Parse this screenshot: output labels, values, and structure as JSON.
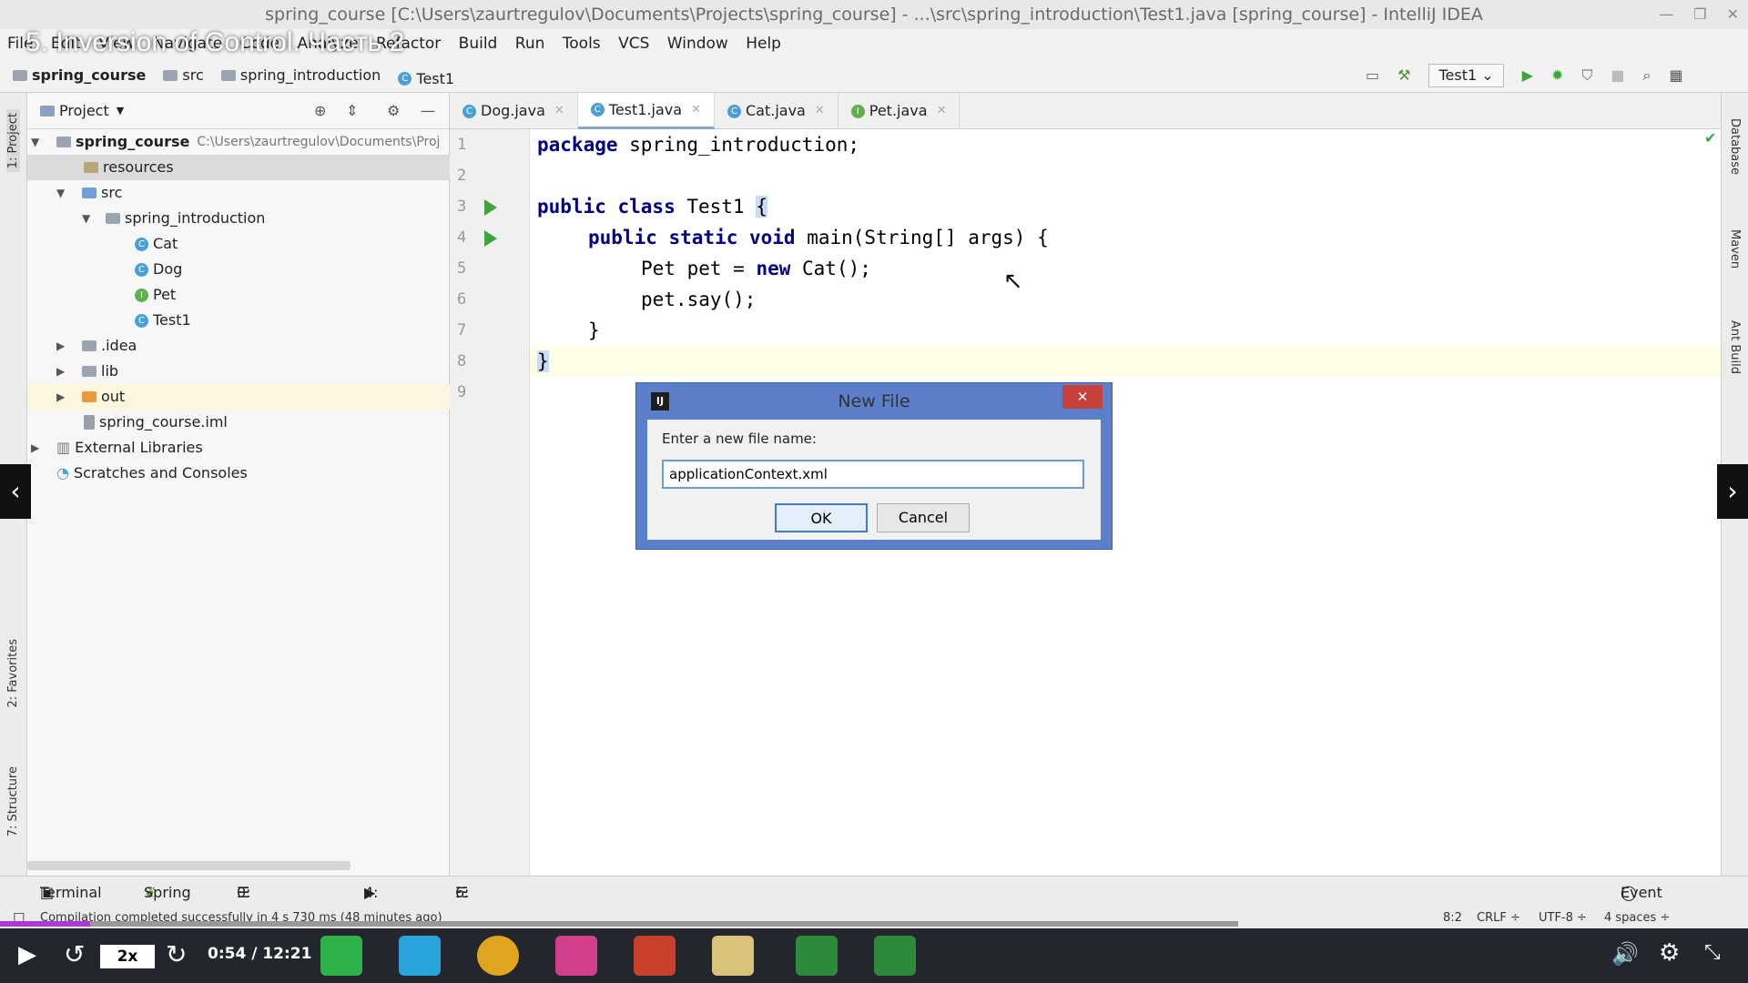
{
  "window": {
    "title": "spring_course [C:\\Users\\zaurtregulov\\Documents\\Projects\\spring_course] - ...\\src\\spring_introduction\\Test1.java [spring_course] - IntelliJ IDEA"
  },
  "video_title": "5. Inversion of Control. Часть 2",
  "menu": [
    "File",
    "Edit",
    "View",
    "Navigate",
    "Code",
    "Analyze",
    "Refactor",
    "Build",
    "Run",
    "Tools",
    "VCS",
    "Window",
    "Help"
  ],
  "navbar": {
    "crumbs": [
      "spring_course",
      "src",
      "spring_introduction",
      "Test1"
    ],
    "run_config": "Test1"
  },
  "project_panel": {
    "title": "Project",
    "tree": [
      {
        "label": "spring_course",
        "extra": "C:\\Users\\zaurtregulov\\Documents\\Proj"
      },
      {
        "label": "resources"
      },
      {
        "label": "src"
      },
      {
        "label": "spring_introduction"
      },
      {
        "label": "Cat",
        "badge": "C"
      },
      {
        "label": "Dog",
        "badge": "C"
      },
      {
        "label": "Pet",
        "badge": "I"
      },
      {
        "label": "Test1",
        "badge": "C"
      },
      {
        "label": ".idea"
      },
      {
        "label": "lib"
      },
      {
        "label": "out"
      },
      {
        "label": "spring_course.iml"
      },
      {
        "label": "External Libraries"
      },
      {
        "label": "Scratches and Consoles"
      }
    ]
  },
  "left_stripe": {
    "project": "1: Project",
    "favorites": "2: Favorites",
    "structure": "7: Structure"
  },
  "right_stripe": {
    "database": "Database",
    "maven": "Maven",
    "ant": "Ant Build"
  },
  "tabs": [
    {
      "label": "Dog.java",
      "badge": "C"
    },
    {
      "label": "Test1.java",
      "badge": "C"
    },
    {
      "label": "Cat.java",
      "badge": "C"
    },
    {
      "label": "Pet.java",
      "badge": "I"
    }
  ],
  "code": {
    "line_numbers": [
      "1",
      "2",
      "3",
      "4",
      "5",
      "6",
      "7",
      "8",
      "9"
    ],
    "l1_kw": "package",
    "l1_rest": " spring_introduction;",
    "l3_kw": "public class",
    "l3_rest": " Test1 ",
    "l3_brace": "{",
    "l4_kw": "public static void",
    "l4_rest": " main(String[] args) {",
    "l5_a": "Pet pet = ",
    "l5_kw": "new",
    "l5_b": " Cat();",
    "l6": "pet.say();",
    "l7": "}",
    "l8": "}"
  },
  "dialog": {
    "title": "New File",
    "label": "Enter a new file name:",
    "value": "applicationContext.xml",
    "ok": "OK",
    "cancel": "Cancel",
    "close": "✕"
  },
  "bottom_tools": [
    "Terminal",
    "Spring",
    "0: Messages",
    "4: Run",
    "6: TODO"
  ],
  "event_log": "Event Log",
  "status": {
    "message": "Compilation completed successfully in 4 s 730 ms (48 minutes ago)",
    "position": "8:2",
    "line_sep": "CRLF ÷",
    "encoding": "UTF-8 ÷",
    "indent": "4 spaces ÷"
  },
  "player": {
    "speed": "2x",
    "time": "0:54 / 12:21",
    "progress_fraction": 0.073
  },
  "colors": {
    "progress": "#b036d6",
    "dialog_border": "#5b7fc8",
    "keyword": "#000080"
  }
}
